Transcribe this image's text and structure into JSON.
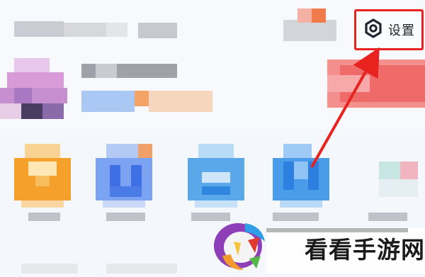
{
  "header": {
    "settings_label": "设置",
    "settings_icon": "gear-icon"
  },
  "watermark": {
    "text": "看看手游网"
  },
  "colors": {
    "highlight_red": "#e8231f",
    "tile_orange": "#f4a02a",
    "tile_blue": "#4b8ef0",
    "tile_light_blue": "#5aa7ea"
  }
}
